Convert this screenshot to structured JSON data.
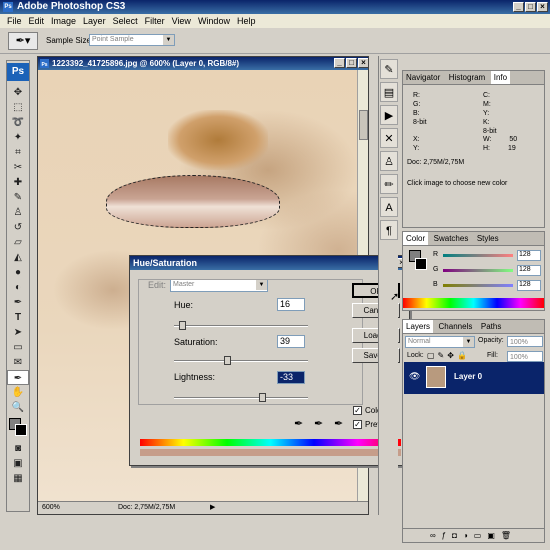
{
  "app": {
    "title": "Adobe Photoshop CS3",
    "logo": "Ps"
  },
  "menu": [
    "File",
    "Edit",
    "Image",
    "Layer",
    "Select",
    "Filter",
    "View",
    "Window",
    "Help"
  ],
  "options_bar": {
    "sample_size_label": "Sample Size:",
    "sample_size_value": "Point Sample"
  },
  "document": {
    "title": "1223392_41725896.jpg @ 600% (Layer 0, RGB/8#)",
    "zoom": "600%",
    "doc_info": "Doc: 2,75M/2,75M"
  },
  "dialog": {
    "title": "Hue/Saturation",
    "edit_label": "Edit:",
    "edit_value": "Master",
    "hue_label": "Hue:",
    "hue_value": "16",
    "saturation_label": "Saturation:",
    "saturation_value": "39",
    "lightness_label": "Lightness:",
    "lightness_value": "-33",
    "ok": "OK",
    "cancel": "Cancel",
    "load": "Load...",
    "save": "Save...",
    "colorize": "Colorize",
    "preview": "Preview",
    "hue_slider_level": 0.04,
    "saturation_slider_level": 0.39,
    "lightness_slider_level": 0.67
  },
  "info_panel": {
    "tabs": [
      "Navigator",
      "Histogram",
      "Info"
    ],
    "r": "R:",
    "g": "G:",
    "b": "B:",
    "bit_left": "8-bit",
    "c": "C:",
    "m": "M:",
    "y": "Y:",
    "k": "K:",
    "bit_right": "8-bit",
    "x": "X:",
    "y2": "Y:",
    "w": "W:",
    "w_value": "50",
    "h": "H:",
    "h_value": "19",
    "doc": "Doc: 2,75M/2,75M",
    "hint": "Click image to choose new color"
  },
  "color_panel": {
    "tabs": [
      "Color",
      "Swatches",
      "Styles"
    ],
    "r_label": "R",
    "r_value": "128",
    "g_label": "G",
    "g_value": "128",
    "b_label": "B",
    "b_value": "128"
  },
  "layers_panel": {
    "tabs": [
      "Layers",
      "Channels",
      "Paths"
    ],
    "mode": "Normal",
    "opacity_label": "Opacity:",
    "opacity_value": "100%",
    "lock_label": "Lock:",
    "fill_label": "Fill:",
    "fill_value": "100%",
    "layer_name": "Layer 0"
  }
}
